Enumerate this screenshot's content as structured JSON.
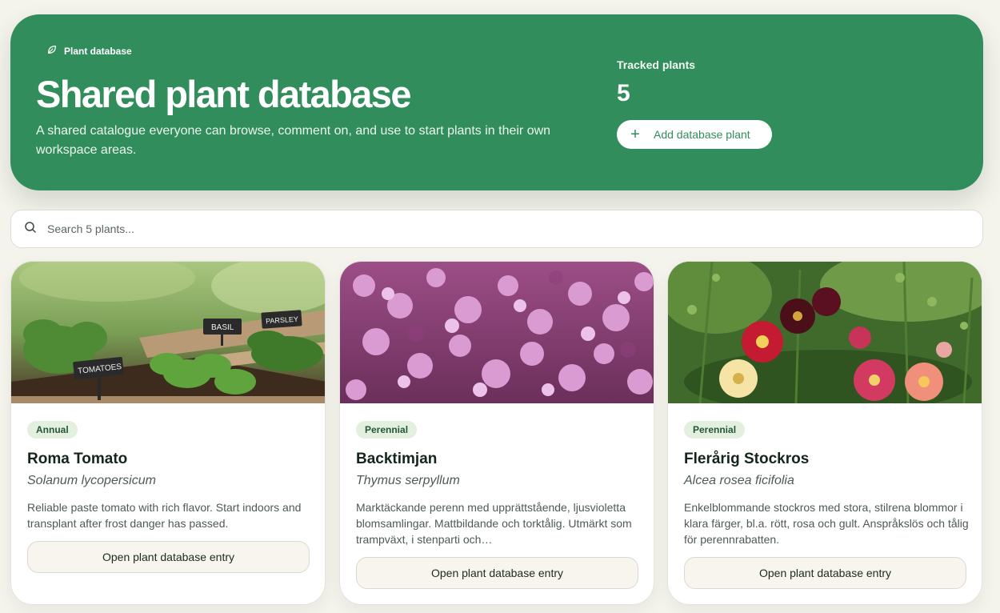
{
  "hero": {
    "eyebrow": "Plant database",
    "title": "Shared plant database",
    "description": "A shared catalogue everyone can browse, comment on, and use to start plants in their own workspace areas.",
    "stat_label": "Tracked plants",
    "stat_value": "5",
    "add_button": "Add database plant",
    "accent_color": "#318e5c"
  },
  "search": {
    "placeholder": "Search 5 plants..."
  },
  "cards": [
    {
      "image": "raised-bed-tomatoes-basil-parsley",
      "image_labels": [
        "TOMATOES",
        "BASIL",
        "PARSLEY"
      ],
      "badge": "Annual",
      "name": "Roma Tomato",
      "scientific": "Solanum lycopersicum",
      "description": "Reliable paste tomato with rich flavor. Start indoors and transplant after frost danger has passed.",
      "button": "Open plant database entry"
    },
    {
      "image": "pink-thyme-flowers",
      "badge": "Perennial",
      "name": "Backtimjan",
      "scientific": "Thymus serpyllum",
      "description": "Marktäckande perenn med upprättstående, ljusvioletta blomsamlingar. Mattbildande och torktålig. Utmärkt som trampväxt, i stenparti och…",
      "button": "Open plant database entry"
    },
    {
      "image": "hollyhock-flowers",
      "badge": "Perennial",
      "name": "Flerårig Stockros",
      "scientific": "Alcea rosea ficifolia",
      "description": "Enkelblommande stockros med stora, stilrena blommor i klara färger, bl.a. rött, rosa och gult. Anspråkslös och tålig för perennrabatten.",
      "button": "Open plant database entry"
    }
  ]
}
